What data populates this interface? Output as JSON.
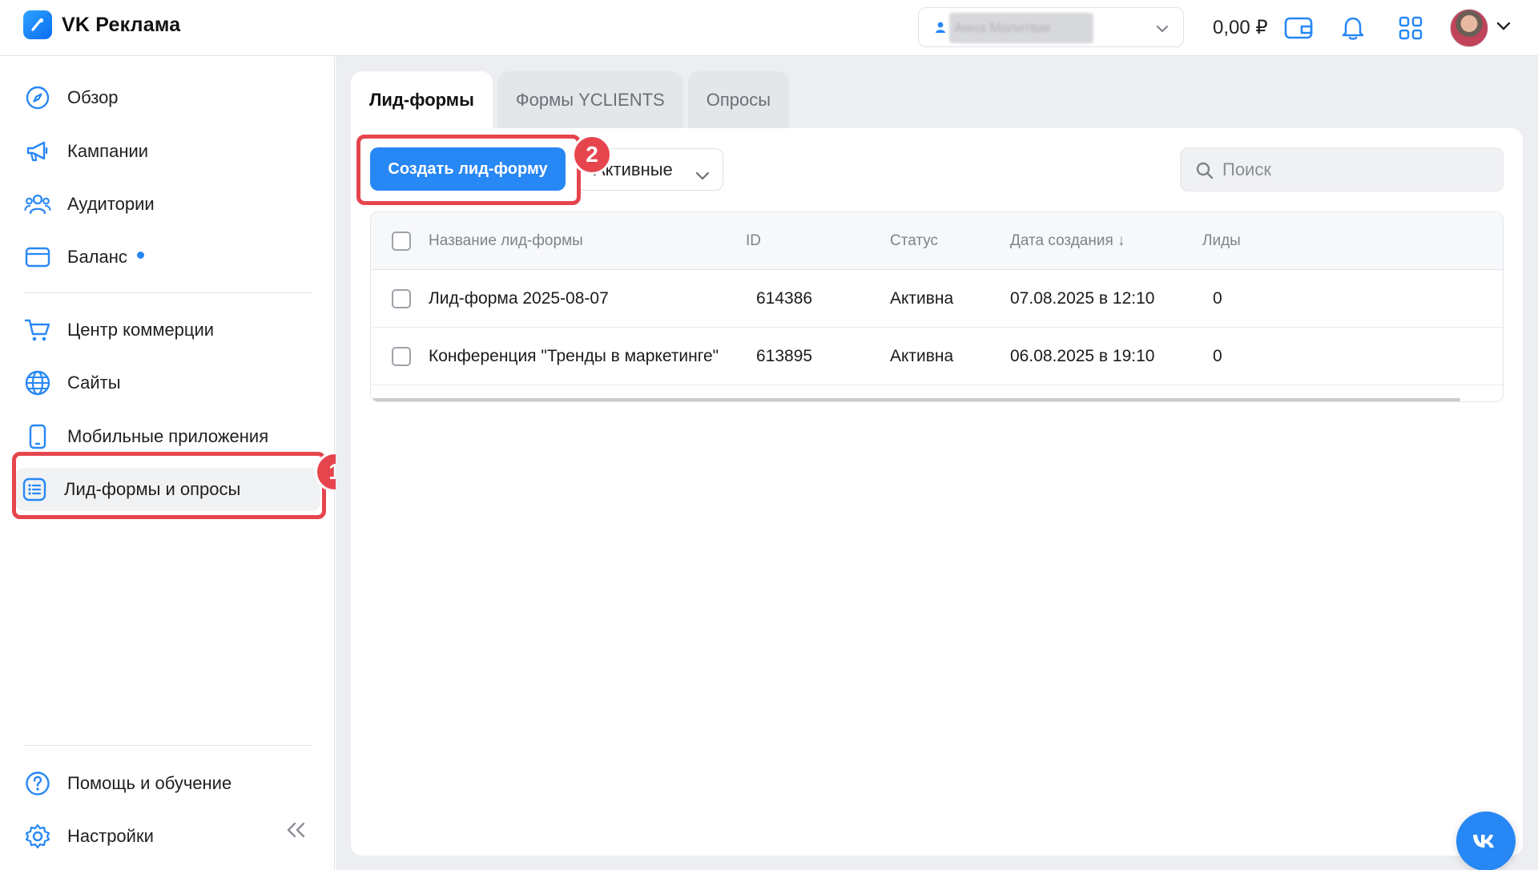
{
  "header": {
    "logo_text": "VK Реклама",
    "account_name": "Анна Молитвик",
    "balance": "0,00 ₽",
    "icons": [
      "wallet-icon",
      "bell-icon",
      "apps-grid-icon",
      "avatar",
      "chevron-down-icon"
    ]
  },
  "sidebar": {
    "items": [
      {
        "label": "Обзор",
        "icon": "compass-icon"
      },
      {
        "label": "Кампании",
        "icon": "megaphone-icon"
      },
      {
        "label": "Аудитории",
        "icon": "users-icon"
      },
      {
        "label": "Баланс",
        "icon": "wallet-icon",
        "has_dot": true
      },
      {
        "label": "Центр коммерции",
        "icon": "cart-icon"
      },
      {
        "label": "Сайты",
        "icon": "globe-icon"
      },
      {
        "label": "Мобильные приложения",
        "icon": "phone-icon"
      },
      {
        "label": "Лид-формы и опросы",
        "icon": "list-icon",
        "active": true
      }
    ],
    "bottom": [
      {
        "label": "Помощь и обучение",
        "icon": "help-icon"
      },
      {
        "label": "Настройки",
        "icon": "gear-icon"
      }
    ]
  },
  "annotations": {
    "step1": "1",
    "step2": "2"
  },
  "tabs": [
    {
      "label": "Лид-формы",
      "active": true
    },
    {
      "label": "Формы YCLIENTS",
      "active": false
    },
    {
      "label": "Опросы",
      "active": false
    }
  ],
  "toolbar": {
    "create_label": "Создать лид-форму",
    "filter_value": "Активные",
    "search_placeholder": "Поиск"
  },
  "table": {
    "columns": [
      "Название лид-формы",
      "ID",
      "Статус",
      "Дата создания ↓",
      "Лиды"
    ],
    "rows": [
      {
        "name": "Лид-форма 2025-08-07",
        "id": "614386",
        "status": "Активна",
        "created": "07.08.2025 в 12:10",
        "leads": "0"
      },
      {
        "name": "Конференция \"Тренды в маркетинге\"",
        "id": "613895",
        "status": "Активна",
        "created": "06.08.2025 в 19:10",
        "leads": "0"
      }
    ]
  },
  "colors": {
    "accent": "#2787f5",
    "annotation": "#e6454e",
    "main_bg": "#eceef1"
  }
}
